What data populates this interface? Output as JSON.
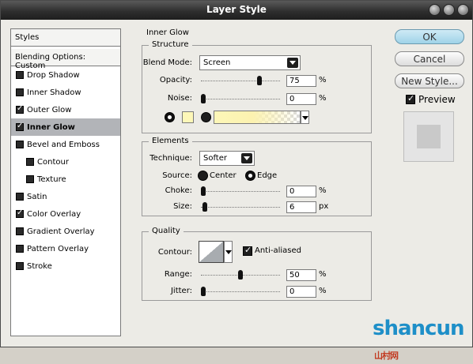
{
  "window": {
    "title": "Layer Style"
  },
  "styles_list": {
    "header": "Styles",
    "blending": "Blending Options: Custom",
    "items": [
      {
        "label": "Drop Shadow",
        "checked": false,
        "selected": false,
        "sub": false
      },
      {
        "label": "Inner Shadow",
        "checked": false,
        "selected": false,
        "sub": false
      },
      {
        "label": "Outer Glow",
        "checked": true,
        "selected": false,
        "sub": false
      },
      {
        "label": "Inner Glow",
        "checked": true,
        "selected": true,
        "sub": false
      },
      {
        "label": "Bevel and Emboss",
        "checked": false,
        "selected": false,
        "sub": false
      },
      {
        "label": "Contour",
        "checked": false,
        "selected": false,
        "sub": true
      },
      {
        "label": "Texture",
        "checked": false,
        "selected": false,
        "sub": true
      },
      {
        "label": "Satin",
        "checked": false,
        "selected": false,
        "sub": false
      },
      {
        "label": "Color Overlay",
        "checked": true,
        "selected": false,
        "sub": false
      },
      {
        "label": "Gradient Overlay",
        "checked": false,
        "selected": false,
        "sub": false
      },
      {
        "label": "Pattern Overlay",
        "checked": false,
        "selected": false,
        "sub": false
      },
      {
        "label": "Stroke",
        "checked": false,
        "selected": false,
        "sub": false
      }
    ]
  },
  "inner_glow": {
    "title": "Inner Glow",
    "structure": {
      "title": "Structure",
      "blend_mode_label": "Blend Mode:",
      "blend_mode": "Screen",
      "opacity_label": "Opacity:",
      "opacity": "75",
      "opacity_unit": "%",
      "opacity_level": 0.75,
      "noise_label": "Noise:",
      "noise": "0",
      "noise_unit": "%",
      "noise_level": 0,
      "glow_color": "#fdf7b8"
    },
    "elements": {
      "title": "Elements",
      "technique_label": "Technique:",
      "technique": "Softer",
      "source_label": "Source:",
      "source_center": "Center",
      "source_edge": "Edge",
      "choke_label": "Choke:",
      "choke": "0",
      "choke_unit": "%",
      "choke_level": 0,
      "size_label": "Size:",
      "size": "6",
      "size_unit": "px",
      "size_level": 0.024
    },
    "quality": {
      "title": "Quality",
      "contour_label": "Contour:",
      "anti_aliased_label": "Anti-aliased",
      "range_label": "Range:",
      "range": "50",
      "range_unit": "%",
      "range_level": 0.5,
      "jitter_label": "Jitter:",
      "jitter": "0",
      "jitter_unit": "%",
      "jitter_level": 0
    }
  },
  "actions": {
    "ok": "OK",
    "cancel": "Cancel",
    "new_style": "New Style...",
    "preview_label": "Preview"
  },
  "watermark": {
    "text": "shancun",
    "suffix": "山村网"
  }
}
